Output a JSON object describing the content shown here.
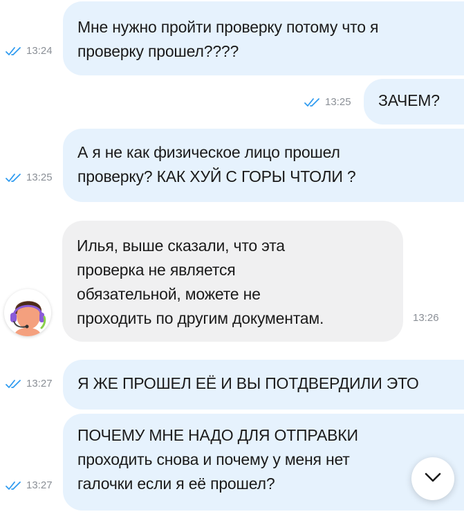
{
  "messages": [
    {
      "direction": "out",
      "lines": [
        "Мне нужно пройти проверку потому что я",
        "проверку прошел????"
      ],
      "time": "13:24",
      "status": "read"
    },
    {
      "direction": "out",
      "lines": [
        "ЗАЧЕМ?"
      ],
      "time": "13:25",
      "status": "read"
    },
    {
      "direction": "out",
      "lines": [
        "А я не как физическое лицо прошел",
        "проверку? КАК ХУЙ С ГОРЫ ЧТОЛИ ?"
      ],
      "time": "13:25",
      "status": "read"
    },
    {
      "direction": "in",
      "lines": [
        "Илья, выше сказали, что эта",
        "проверка не является",
        "обязательной, можете не",
        "проходить по другим документам."
      ],
      "time": "13:26"
    },
    {
      "direction": "out",
      "lines": [
        "Я ЖЕ ПРОШЕЛ ЕЁ И ВЫ ПОТДВЕРДИЛИ ЭТО"
      ],
      "time": "13:27",
      "status": "read"
    },
    {
      "direction": "out",
      "lines": [
        "ПОЧЕМУ МНЕ НАДО ДЛЯ ОТПРАВКИ",
        "проходить снова и почему у меня нет",
        "галочки если я её прошел?"
      ],
      "time": "13:27",
      "status": "read"
    }
  ],
  "icons": {
    "read_status": "double-check-icon",
    "scroll_down": "chevron-down-icon",
    "support_avatar": "support-agent-avatar"
  },
  "colors": {
    "outgoing_bubble": "#e6f2fd",
    "incoming_bubble": "#f0f0f1",
    "read_check": "#2f9bf0",
    "timestamp": "#8a8f96"
  }
}
